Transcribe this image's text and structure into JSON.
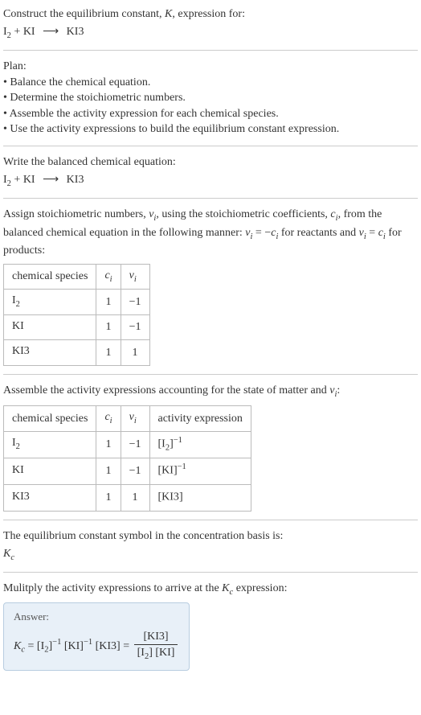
{
  "header": {
    "line1_prefix": "Construct the equilibrium constant, ",
    "line1_K": "K",
    "line1_suffix": ", expression for:",
    "equation_lhs1": "I",
    "equation_lhs1_sub": "2",
    "equation_plus": " + KI",
    "equation_arrow": "⟶",
    "equation_rhs": "KI3"
  },
  "plan": {
    "title": "Plan:",
    "b1": "• Balance the chemical equation.",
    "b2": "• Determine the stoichiometric numbers.",
    "b3": "• Assemble the activity expression for each chemical species.",
    "b4": "• Use the activity expressions to build the equilibrium constant expression."
  },
  "balanced": {
    "intro": "Write the balanced chemical equation:",
    "lhs1": "I",
    "lhs1_sub": "2",
    "plus": " + KI",
    "arrow": "⟶",
    "rhs": "KI3"
  },
  "stoich": {
    "intro_a": "Assign stoichiometric numbers, ",
    "nu": "ν",
    "nu_sub": "i",
    "intro_b": ", using the stoichiometric coefficients, ",
    "c": "c",
    "c_sub": "i",
    "intro_c": ", from the balanced chemical equation in the following manner: ",
    "rel1_a": "ν",
    "rel1_b": "i",
    "rel1_eq": " = −",
    "rel1_c": "c",
    "rel1_d": "i",
    "intro_d": " for reactants and ",
    "rel2_a": "ν",
    "rel2_b": "i",
    "rel2_eq": " = ",
    "rel2_c": "c",
    "rel2_d": "i",
    "intro_e": " for products:"
  },
  "table1": {
    "h1": "chemical species",
    "h2_a": "c",
    "h2_b": "i",
    "h3_a": "ν",
    "h3_b": "i",
    "rows": [
      {
        "sp_a": "I",
        "sp_sub": "2",
        "c": "1",
        "nu": "−1"
      },
      {
        "sp_a": "KI",
        "sp_sub": "",
        "c": "1",
        "nu": "−1"
      },
      {
        "sp_a": "KI3",
        "sp_sub": "",
        "c": "1",
        "nu": "1"
      }
    ]
  },
  "activity_intro_a": "Assemble the activity expressions accounting for the state of matter and ",
  "activity_intro_nu": "ν",
  "activity_intro_sub": "i",
  "activity_intro_b": ":",
  "table2": {
    "h1": "chemical species",
    "h2_a": "c",
    "h2_b": "i",
    "h3_a": "ν",
    "h3_b": "i",
    "h4": "activity expression",
    "rows": [
      {
        "sp_a": "I",
        "sp_sub": "2",
        "c": "1",
        "nu": "−1",
        "act_a": "[I",
        "act_sub": "2",
        "act_b": "]",
        "act_sup": "−1"
      },
      {
        "sp_a": "KI",
        "sp_sub": "",
        "c": "1",
        "nu": "−1",
        "act_a": "[KI",
        "act_sub": "",
        "act_b": "]",
        "act_sup": "−1"
      },
      {
        "sp_a": "KI3",
        "sp_sub": "",
        "c": "1",
        "nu": "1",
        "act_a": "[KI3",
        "act_sub": "",
        "act_b": "]",
        "act_sup": ""
      }
    ]
  },
  "symbol": {
    "intro": "The equilibrium constant symbol in the concentration basis is:",
    "K": "K",
    "K_sub": "c"
  },
  "multiply": {
    "intro_a": "Mulitply the activity expressions to arrive at the ",
    "K": "K",
    "K_sub": "c",
    "intro_b": " expression:"
  },
  "answer": {
    "label": "Answer:",
    "K": "K",
    "K_sub": "c",
    "eq": " = ",
    "t1_a": "[I",
    "t1_sub": "2",
    "t1_b": "]",
    "t1_sup": "−1",
    "t2_a": " [KI]",
    "t2_sup": "−1",
    "t3": " [KI3] = ",
    "num": "[KI3]",
    "den_a": "[I",
    "den_sub": "2",
    "den_b": "] [KI]"
  }
}
